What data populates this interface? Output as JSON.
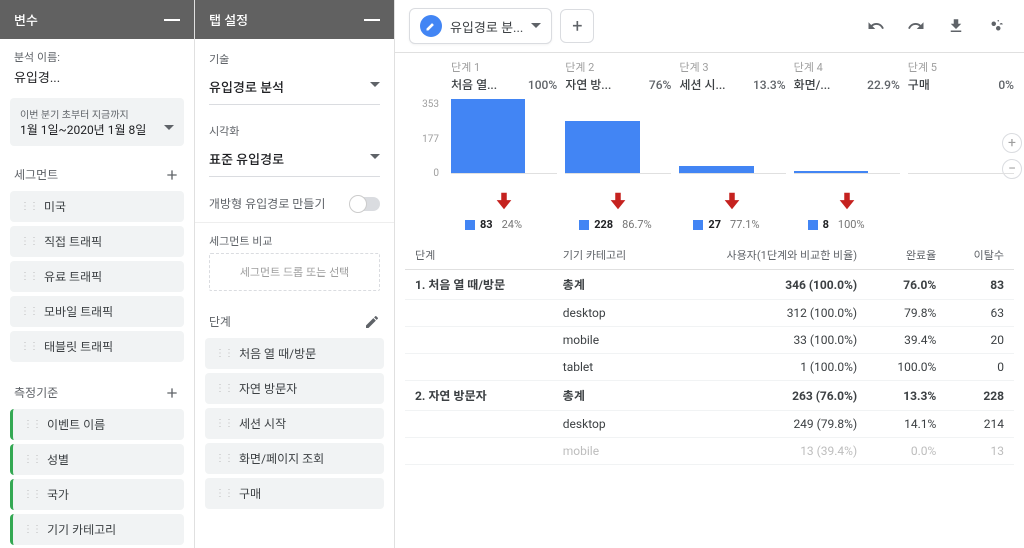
{
  "panels": {
    "vars_title": "변수",
    "tab_title": "탭 설정",
    "analysis_label": "분석 이름:",
    "analysis_name": "유입경...",
    "date_range_label": "이번 분기 초부터 지금까지",
    "date_range_value": "1월 1일~2020년 1월 8일",
    "segments_label": "세그먼트",
    "segments": [
      "미국",
      "직접 트래픽",
      "유료 트래픽",
      "모바일 트래픽",
      "태블릿 트래픽"
    ],
    "metrics_label": "측정기준",
    "metrics": [
      "이벤트 이름",
      "성별",
      "국가",
      "기기 카테고리"
    ]
  },
  "tab_settings": {
    "technique_label": "기술",
    "technique_value": "유입경로 분석",
    "viz_label": "시각화",
    "viz_value": "표준 유입경로",
    "open_funnel_label": "개방형 유입경로 만들기",
    "seg_compare_label": "세그먼트 비교",
    "seg_drop_placeholder": "세그먼트 드롭 또는 선택",
    "steps_label": "단계",
    "steps": [
      "처음 열 때/방문",
      "자연 방문자",
      "세션 시작",
      "화면/페이지 조회",
      "구매"
    ]
  },
  "tab_bar": {
    "active_tab_label": "유입경로 분..."
  },
  "funnel": {
    "step_label_prefix": "단계",
    "axis": [
      "353",
      "177",
      "0"
    ],
    "steps": [
      {
        "n": "1",
        "name": "처음 열...",
        "pct": "100%",
        "bar": 100
      },
      {
        "n": "2",
        "name": "자연 방...",
        "pct": "76%",
        "bar": 70
      },
      {
        "n": "3",
        "name": "세션 시...",
        "pct": "13.3%",
        "bar": 9
      },
      {
        "n": "4",
        "name": "화면/...",
        "pct": "22.9%",
        "bar": 3
      },
      {
        "n": "5",
        "name": "구매",
        "pct": "0%",
        "bar": 0
      }
    ],
    "drops": [
      {
        "n": "83",
        "pct": "24%"
      },
      {
        "n": "228",
        "pct": "86.7%"
      },
      {
        "n": "27",
        "pct": "77.1%"
      },
      {
        "n": "8",
        "pct": "100%"
      }
    ]
  },
  "table": {
    "headers": [
      "단계",
      "기기 카테고리",
      "사용자(1단계와 비교한 비율)",
      "완료율",
      "이탈수"
    ],
    "rows": [
      {
        "bold": true,
        "step": "1. 처음 열 때/방문",
        "cat": "총계",
        "users": "346 (100.0%)",
        "rate": "76.0%",
        "drop": "83"
      },
      {
        "step": "",
        "cat": "desktop",
        "users": "312 (100.0%)",
        "rate": "79.8%",
        "drop": "63"
      },
      {
        "step": "",
        "cat": "mobile",
        "users": "33 (100.0%)",
        "rate": "39.4%",
        "drop": "20"
      },
      {
        "step": "",
        "cat": "tablet",
        "users": "1 (100.0%)",
        "rate": "100.0%",
        "drop": "0"
      },
      {
        "bold": true,
        "step": "2. 자연 방문자",
        "cat": "총계",
        "users": "263 (76.0%)",
        "rate": "13.3%",
        "drop": "228"
      },
      {
        "step": "",
        "cat": "desktop",
        "users": "249 (79.8%)",
        "rate": "14.1%",
        "drop": "214"
      },
      {
        "dim": true,
        "step": "",
        "cat": "mobile",
        "users": "13 (39.4%)",
        "rate": "0.0%",
        "drop": "13"
      }
    ]
  },
  "chart_data": {
    "type": "bar",
    "title": "유입경로 분석",
    "categories": [
      "처음 열 때/방문",
      "자연 방문자",
      "세션 시작",
      "화면/페이지 조회",
      "구매"
    ],
    "values": [
      346,
      263,
      35,
      8,
      0
    ],
    "step_pct_of_first": [
      100,
      76,
      13.3,
      22.9,
      0
    ],
    "dropoffs": [
      {
        "from_step": 1,
        "count": 83,
        "pct": 24
      },
      {
        "from_step": 2,
        "count": 228,
        "pct": 86.7
      },
      {
        "from_step": 3,
        "count": 27,
        "pct": 77.1
      },
      {
        "from_step": 4,
        "count": 8,
        "pct": 100
      }
    ],
    "ylim": [
      0,
      353
    ],
    "y_ticks": [
      0,
      177,
      353
    ],
    "ylabel": "사용자"
  }
}
